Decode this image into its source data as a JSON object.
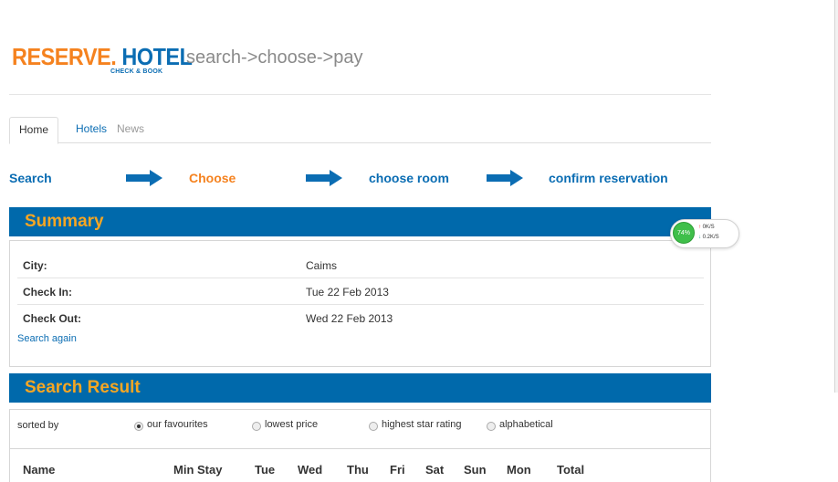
{
  "logo": {
    "brand_part1": "RESERVE.",
    "brand_part2": "HOTEL",
    "tagline": "CHECK & BOOK"
  },
  "slogan": "search->choose->pay",
  "tabs": [
    {
      "label": "Home"
    },
    {
      "label": "Hotels"
    },
    {
      "label": "News"
    }
  ],
  "steps": [
    {
      "label": "Search"
    },
    {
      "label": "Choose"
    },
    {
      "label": "choose room"
    },
    {
      "label": "confirm reservation"
    }
  ],
  "summary": {
    "title": "Summary",
    "rows": [
      {
        "key": "City:",
        "value": "Caims"
      },
      {
        "key": "Check In:",
        "value": "Tue 22 Feb 2013"
      },
      {
        "key": "Check Out:",
        "value": "Wed 22 Feb 2013"
      }
    ],
    "search_again": "Search again"
  },
  "results": {
    "title": "Search Result",
    "sorted_by": "sorted by",
    "options": [
      {
        "label": "our favourites",
        "selected": true
      },
      {
        "label": "lowest price",
        "selected": false
      },
      {
        "label": "highest star rating",
        "selected": false
      },
      {
        "label": "alphabetical",
        "selected": false
      }
    ],
    "columns": [
      "Name",
      "Min Stay",
      "Tue",
      "Wed",
      "Thu",
      "Fri",
      "Sat",
      "Sun",
      "Mon",
      "Total"
    ]
  },
  "net_widget": {
    "percent": "74%",
    "up": "0K/S",
    "down": "0.2K/S"
  },
  "colors": {
    "brand_blue": "#0069ab",
    "accent_orange": "#f5821f"
  }
}
